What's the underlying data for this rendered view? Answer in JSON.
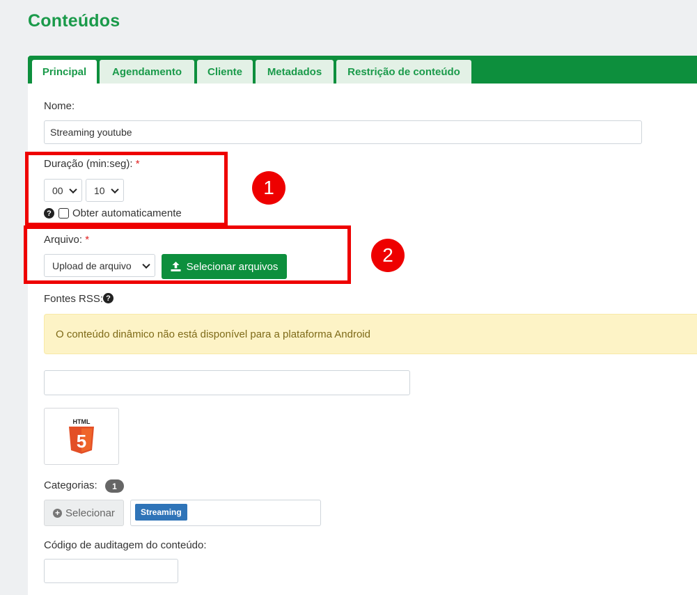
{
  "page": {
    "title": "Conteúdos"
  },
  "tabs": [
    {
      "label": "Principal",
      "active": true
    },
    {
      "label": "Agendamento",
      "active": false
    },
    {
      "label": "Cliente",
      "active": false
    },
    {
      "label": "Metadados",
      "active": false
    },
    {
      "label": "Restrição de conteúdo",
      "active": false
    }
  ],
  "form": {
    "nome_label": "Nome:",
    "nome_value": "Streaming youtube",
    "duracao_label": "Duração (min:seg):",
    "required_mark": "*",
    "duracao_min": "00",
    "duracao_seg": "10",
    "obter_auto_label": "Obter automaticamente",
    "arquivo_label": "Arquivo:",
    "arquivo_select": "Upload de arquivo",
    "selecionar_arquivos": "Selecionar arquivos",
    "fontes_rss_label": "Fontes RSS:",
    "alert_text": "O conteúdo dinâmico não está disponível para a plataforma Android",
    "rss_input_value": "",
    "thumb_label": "HTML",
    "thumb_number": "5",
    "categorias_label": "Categorias:",
    "categorias_count": "1",
    "selecionar_label": "Selecionar",
    "categoria_tag": "Streaming",
    "codigo_label": "Código de auditagem do conteúdo:",
    "codigo_value": ""
  },
  "annotations": {
    "marker_1": "1",
    "marker_2": "2"
  },
  "icons": {
    "help": "question-circle-icon",
    "upload": "upload-icon",
    "plus": "plus-circle-icon",
    "html5": "html5-icon"
  },
  "colors": {
    "brand_green": "#0d8f3d",
    "title_green": "#1a9a4a",
    "alert_bg": "#fdf3c6",
    "tag_blue": "#2f74b8",
    "annotation_red": "#ee0000"
  }
}
